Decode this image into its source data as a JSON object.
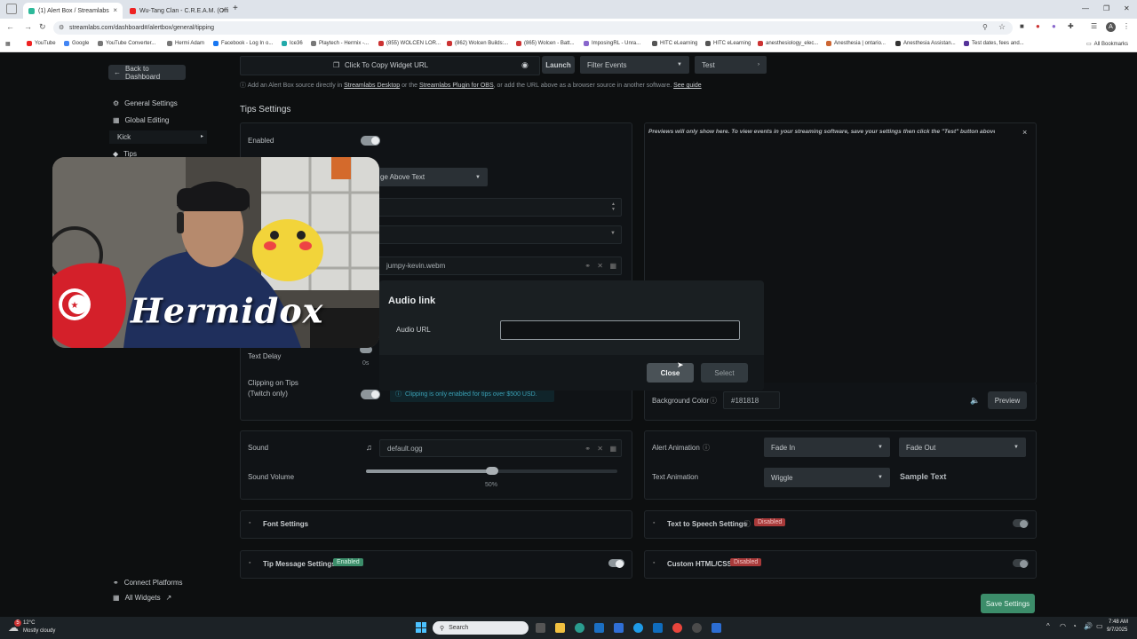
{
  "browser": {
    "tabs": [
      {
        "title": "(1) Alert Box / Streamlabs",
        "active": true
      },
      {
        "title": "Wu-Tang Clan - C.R.E.A.M. (Offi",
        "active": false
      }
    ],
    "new_tab": "+",
    "url": "streamlabs.com/dashboard#/alertbox/general/tipping",
    "bookmarks": [
      "YouTube",
      "Google",
      "YouTube Converter...",
      "Hermi Adam",
      "Facebook - Log In o...",
      "Ice36",
      "Playtech - Hermix -...",
      "(855) WOLCEN LOR...",
      "(862) Wolcen Builds:...",
      "(865) Wolcen - Batt...",
      "ImposingRL - Unra...",
      "HITC eLearning",
      "HITC eLearning",
      "anesthesiology_elec...",
      "Anesthesia | ontario...",
      "Anesthesia Assistan...",
      "Test dates, fees and..."
    ],
    "all_bookmarks": "All Bookmarks",
    "profile_letter": "A"
  },
  "header": {
    "copy_widget": "Click To Copy Widget URL",
    "launch": "Launch",
    "filter_events": "Filter Events",
    "test": "Test",
    "info_prefix": "Add an Alert Box source directly in",
    "info_link1": "Streamlabs Desktop",
    "info_mid": "or the",
    "info_link2": "Streamlabs Plugin for OBS",
    "info_suffix": ", or add the URL above as a browser source in another software.",
    "info_link3": "See guide"
  },
  "sidebar": {
    "back": "Back to Dashboard",
    "items": [
      "General Settings",
      "Global Editing"
    ],
    "kick": "Kick",
    "tips": "Tips",
    "connect_platforms": "Connect Platforms",
    "all_widgets": "All Widgets"
  },
  "main": {
    "section_title": "Tips Settings",
    "enabled": "Enabled",
    "layout_value": "ge Above Text",
    "media_file": "jumpy-kevin.webm",
    "text_delay": "Text Delay",
    "text_delay_value": "0s",
    "clipping_label_1": "Clipping on Tips",
    "clipping_label_2": "(Twitch only)",
    "clipping_info": "Clipping is only enabled for tips over $500 USD.",
    "sound": "Sound",
    "sound_file": "default.ogg",
    "sound_volume": "Sound Volume",
    "volume_value": "50%",
    "volume_fraction": 0.5,
    "font_settings": "Font Settings",
    "tip_message_settings": "Tip Message Settings",
    "tip_message_badge": "Enabled"
  },
  "preview": {
    "note": "Previews will only show here. To view events in your streaming software, save your settings then click the \"Test\" button above.",
    "close": "×",
    "bg_color_label": "Background Color",
    "bg_color_value": "#181818",
    "preview_btn": "Preview",
    "alert_animation": "Alert Animation",
    "fade_in": "Fade In",
    "fade_out": "Fade Out",
    "text_animation": "Text Animation",
    "wiggle": "Wiggle",
    "sample_text": "Sample Text",
    "tts": "Text to Speech Settings",
    "tts_badge": "Disabled",
    "custom_html": "Custom HTML/CSS",
    "custom_badge": "Disabled",
    "save": "Save Settings"
  },
  "modal": {
    "title": "Audio link",
    "field_label": "Audio URL",
    "field_value": "",
    "close": "Close",
    "select": "Select"
  },
  "overlay": {
    "name": "Hermidox"
  },
  "taskbar": {
    "weather_temp": "12°C",
    "weather_desc": "Mostly cloudy",
    "search": "Search",
    "time": "7:48 AM",
    "date": "9/7/2025",
    "notification_count": "5"
  },
  "colors": {
    "accent_green": "#3c8d6a",
    "disabled_red": "#a83a3a",
    "page_bg": "#0d0f10"
  }
}
